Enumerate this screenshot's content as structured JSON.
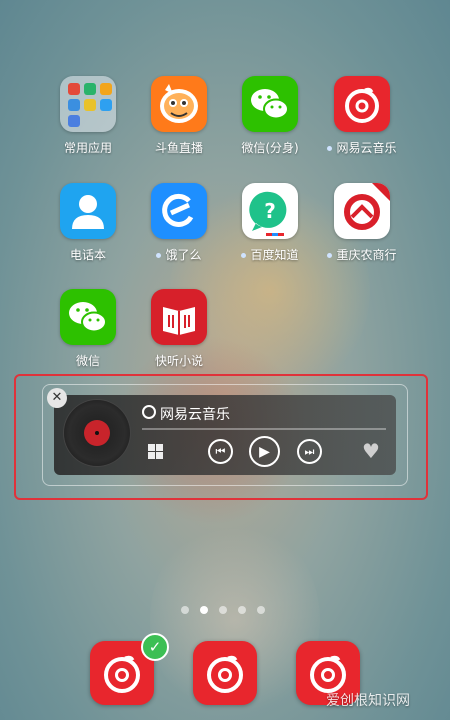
{
  "apps": [
    {
      "label": "常用应用",
      "dot": false
    },
    {
      "label": "斗鱼直播",
      "dot": false
    },
    {
      "label": "微信(分身)",
      "dot": false
    },
    {
      "label": "网易云音乐",
      "dot": true
    },
    {
      "label": "电话本",
      "dot": false
    },
    {
      "label": "饿了么",
      "dot": true
    },
    {
      "label": "百度知道",
      "dot": true
    },
    {
      "label": "重庆农商行",
      "dot": true
    },
    {
      "label": "微信",
      "dot": false
    },
    {
      "label": "快听小说",
      "dot": false
    }
  ],
  "widget": {
    "app_name": "网易云音乐",
    "close_symbol": "✕",
    "prev_symbol": "⏮",
    "play_symbol": "▶",
    "next_symbol": "⏭",
    "heart_symbol": "♥"
  },
  "pages": {
    "count": 5,
    "active_index": 1
  },
  "dock": {
    "check_symbol": "✓"
  },
  "watermark": "爱创根知识网",
  "colors": {
    "netease_red": "#e8262d",
    "highlight_red": "#e0323a",
    "wechat_green": "#2dc100",
    "douyu_orange": "#ff7a1a",
    "phone_blue": "#1fa4f0",
    "eleme_blue": "#1e8fff",
    "zhidao_green": "#1fc28a",
    "bank_red": "#d9202a",
    "kuaiting_red": "#d7202a"
  },
  "icons": [
    "folder-icon",
    "douyu-icon",
    "wechat-clone-icon",
    "netease-cloud-music-icon",
    "contacts-icon",
    "eleme-icon",
    "baidu-zhidao-icon",
    "chongqing-bank-icon",
    "wechat-icon",
    "kuaiting-novel-icon"
  ]
}
